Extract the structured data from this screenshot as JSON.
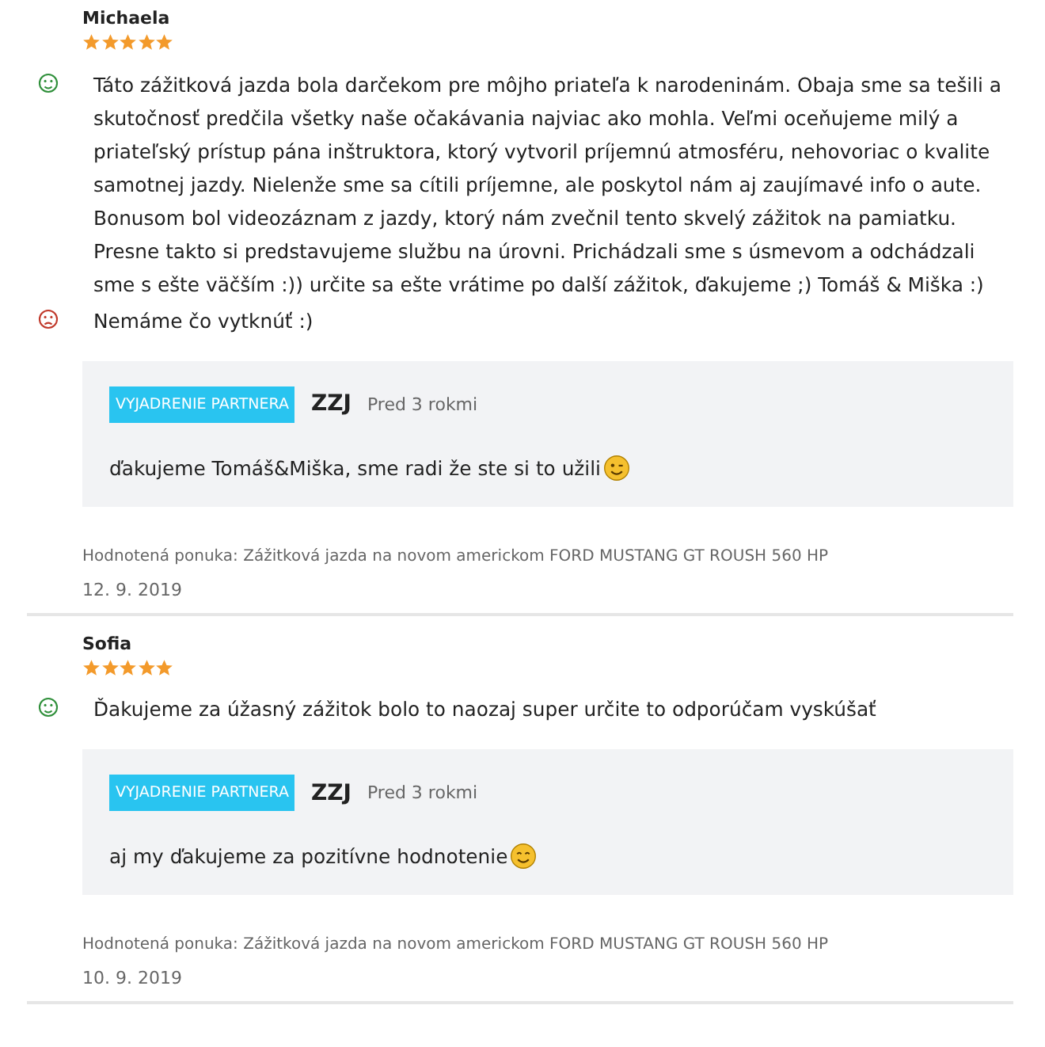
{
  "reviews": [
    {
      "author": "Michaela",
      "stars": 5,
      "points": [
        {
          "kind": "positive",
          "text": "Táto zážitková jazda bola darčekom pre môjho priateľa k narodeninám. Obaja sme sa tešili a skutočnosť predčila všetky naše očakávania najviac ako mohla. Veľmi oceňujeme milý a priateľský prístup pána inštruktora, ktorý vytvoril príjemnú atmosféru, nehovoriac o kvalite samotnej jazdy. Nielenže sme sa cítili príjemne, ale poskytol nám aj zaujímavé info o aute. Bonusom bol videozáznam z jazdy, ktorý nám zvečnil tento skvelý zážitok na pamiatku. Presne takto si predstavujeme službu na úrovni. Prichádzali sme s úsmevom a odchádzali sme s ešte väčším :)) určite sa ešte vrátime po další zážitok, ďakujeme ;) Tomáš & Miška :)"
        },
        {
          "kind": "negative",
          "text": "Nemáme čo vytknúť :)"
        }
      ],
      "reply": {
        "badge": "VYJADRENIE PARTNERA",
        "partner": "ZZJ",
        "time": "Pred 3 rokmi",
        "text": "ďakujeme Tomáš&Miška, sme radi že ste si to užili",
        "kind": "wink"
      },
      "offer": "Hodnotená ponuka: Zážitková jazda na novom americkom FORD MUSTANG GT ROUSH 560 HP",
      "date": "12. 9. 2019"
    },
    {
      "author": "Sofia",
      "stars": 5,
      "points": [
        {
          "kind": "positive",
          "text": "Ďakujeme za úžasný zážitok bolo to naozaj super určite to odporúčam vyskúšať"
        }
      ],
      "reply": {
        "badge": "VYJADRENIE PARTNERA",
        "partner": "ZZJ",
        "time": "Pred 3 rokmi",
        "text": "aj my ďakujeme za pozitívne hodnotenie",
        "kind": "smile"
      },
      "offer": "Hodnotená ponuka: Zážitková jazda na novom americkom FORD MUSTANG GT ROUSH 560 HP",
      "date": "10. 9. 2019"
    }
  ]
}
